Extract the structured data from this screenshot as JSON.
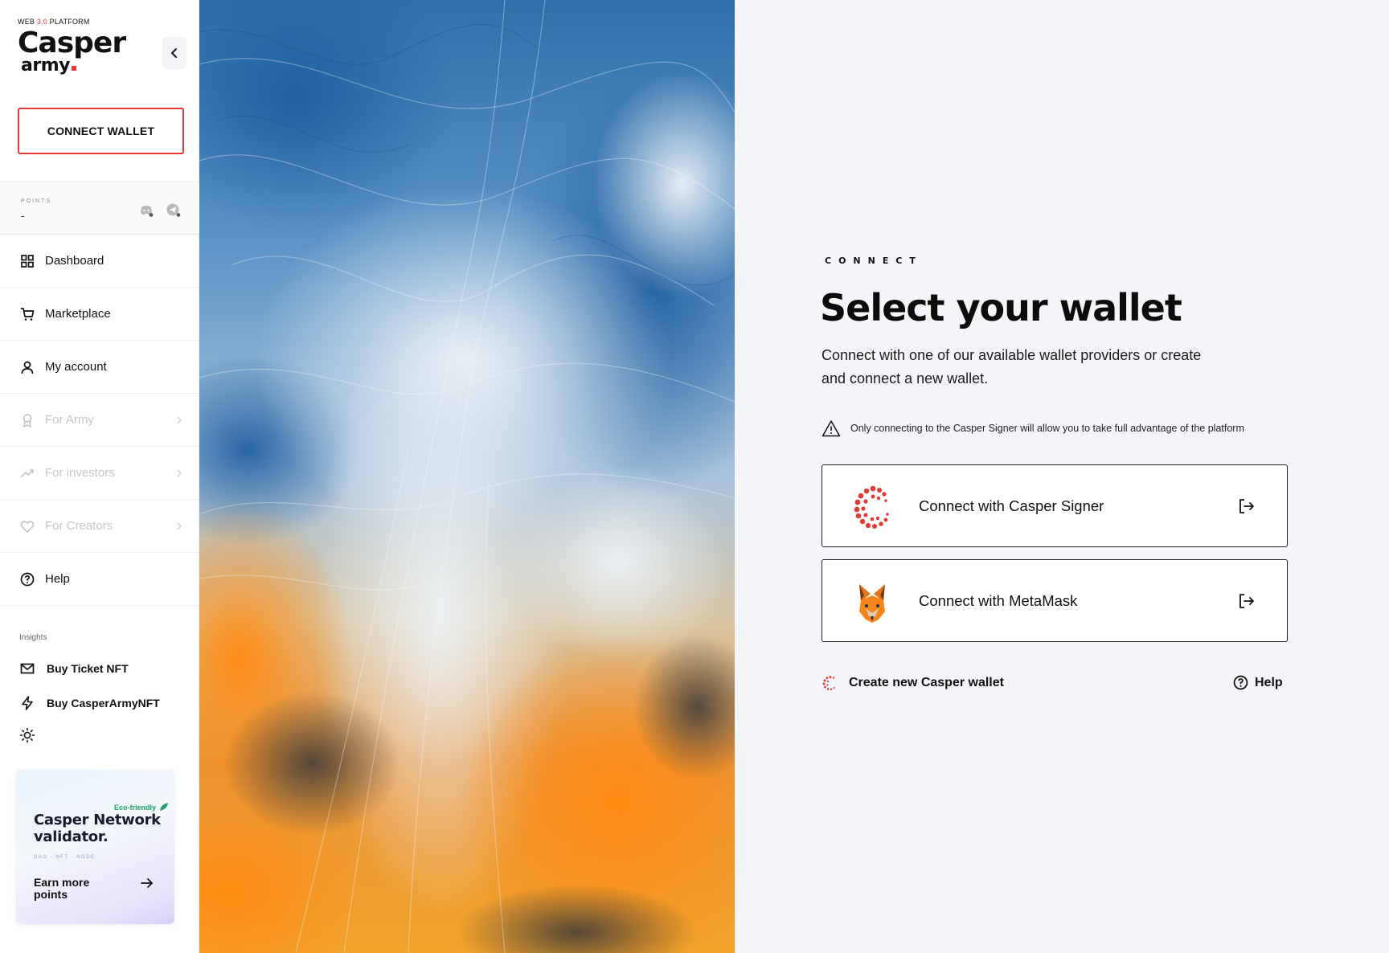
{
  "brand": {
    "tag_prefix": "WEB ",
    "tag_version": "3.0",
    "tag_suffix": " PLATFORM",
    "name": "Casper",
    "sub": "army"
  },
  "sidebar": {
    "connect_label": "CONNECT WALLET",
    "points_label": "POINTS",
    "points_value": "-",
    "nav": [
      {
        "label": "Dashboard",
        "icon": "grid-icon"
      },
      {
        "label": "Marketplace",
        "icon": "cart-icon"
      },
      {
        "label": "My account",
        "icon": "user-icon"
      },
      {
        "label": "For Army",
        "icon": "medal-icon",
        "disabled": true
      },
      {
        "label": "For investors",
        "icon": "trending-up-icon",
        "disabled": true
      },
      {
        "label": "For Creators",
        "icon": "heart-icon",
        "disabled": true
      },
      {
        "label": "Help",
        "icon": "help-circle-icon"
      }
    ],
    "insights_label": "Insights",
    "insights": [
      {
        "label": "Buy Ticket NFT",
        "icon": "mail-icon"
      },
      {
        "label": "Buy CasperArmyNFT",
        "icon": "bolt-icon"
      }
    ]
  },
  "promo": {
    "eco": "Eco-friendly",
    "title": "Casper Network validator.",
    "tags": "DAO · NFT · NODE",
    "cta": "Earn more points"
  },
  "connect": {
    "eyebrow": "CONNECT",
    "title": "Select your wallet",
    "subtitle": "Connect with one of our available wallet providers or create and connect a new wallet.",
    "notice": "Only connecting to the Casper Signer will allow you to take full advantage of the platform",
    "wallets": [
      {
        "label": "Connect with Casper Signer",
        "icon": "casper-signer-logo"
      },
      {
        "label": "Connect with MetaMask",
        "icon": "metamask-fox-logo"
      }
    ],
    "create_label": "Create new Casper wallet",
    "help_label": "Help"
  },
  "colors": {
    "accent": "#e53935",
    "panel_bg": "#f4f5f9",
    "eco_green": "#21a36b"
  }
}
